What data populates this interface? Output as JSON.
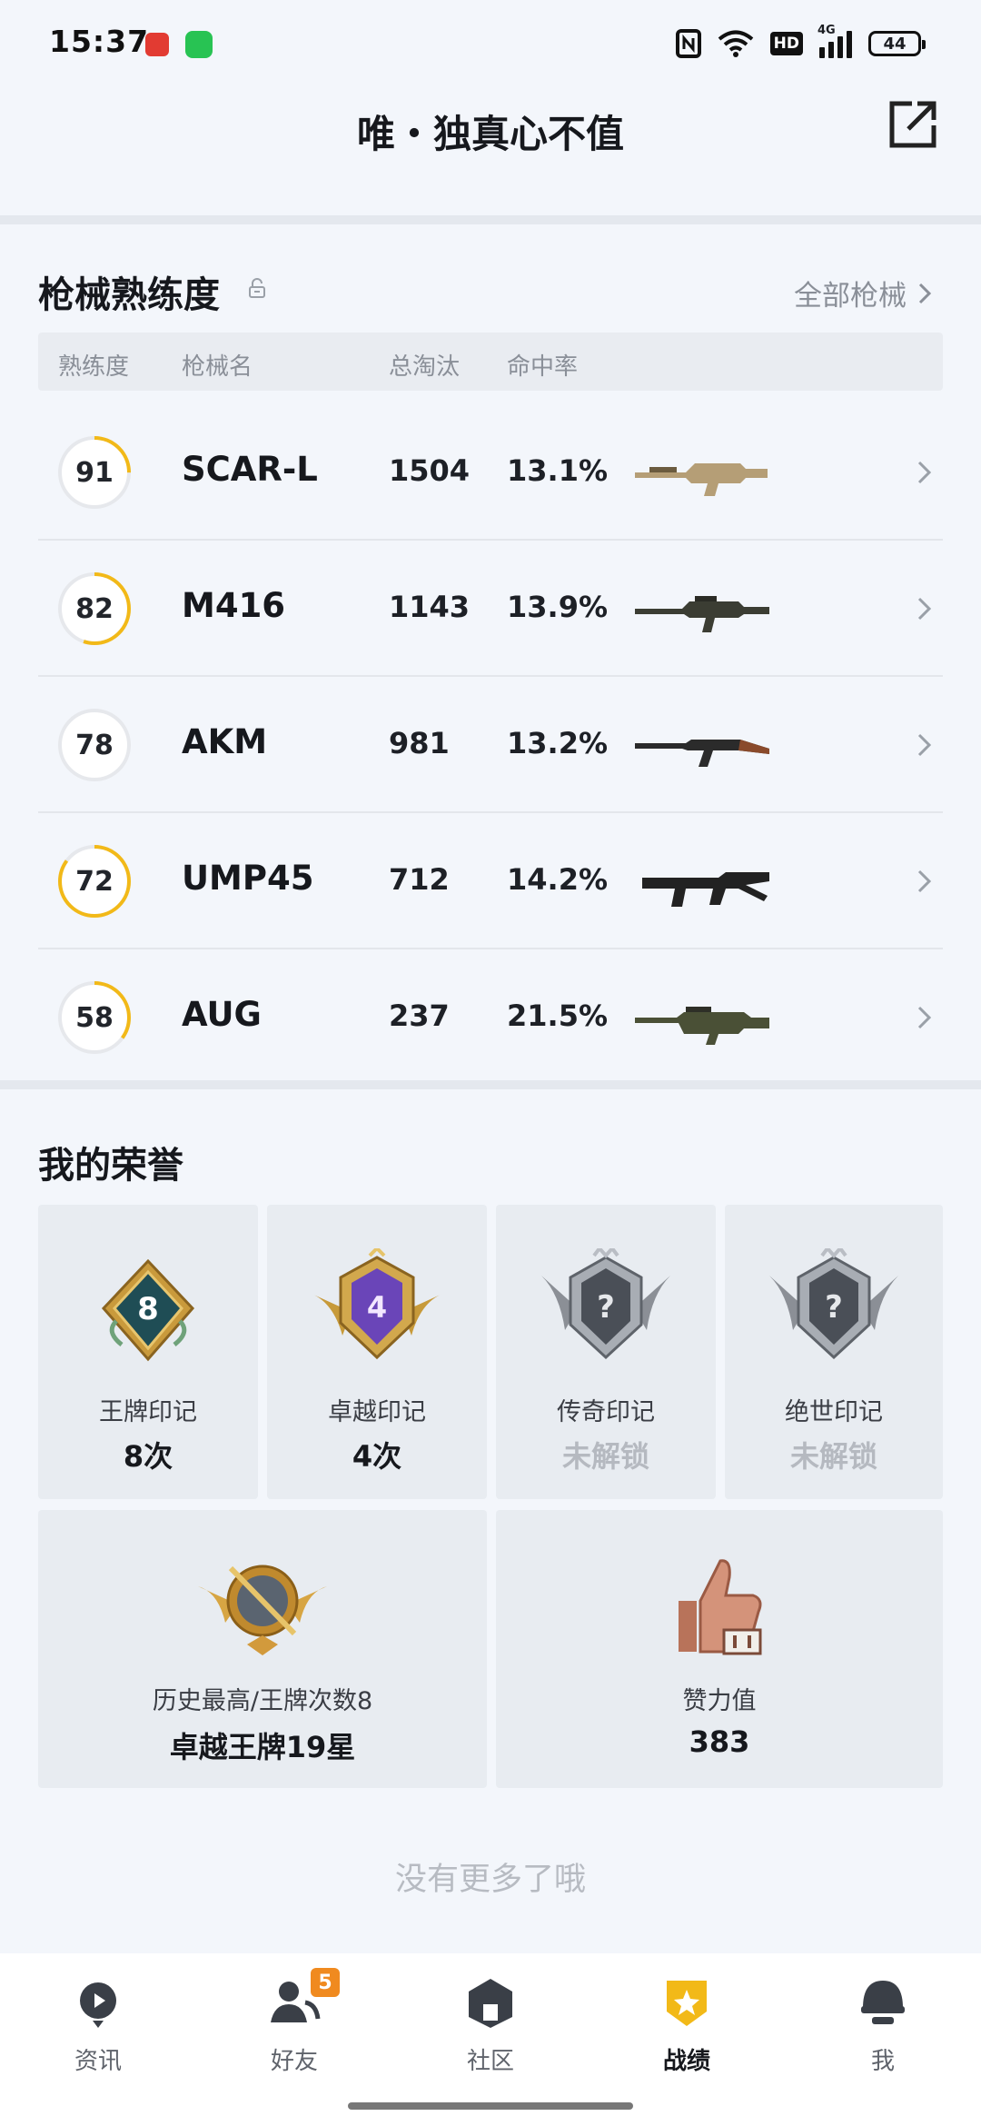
{
  "status_bar": {
    "time": "15:37",
    "network": "4G",
    "hd": "HD",
    "battery": "44"
  },
  "header": {
    "title": "唯・独真心不值"
  },
  "weapons": {
    "title": "枪械熟练度",
    "all_link": "全部枪械",
    "columns": [
      "熟练度",
      "枪械名",
      "总淘汰",
      "命中率"
    ],
    "rows": [
      {
        "proficiency": "91",
        "fill": 0.25,
        "name": "SCAR-L",
        "kills": "1504",
        "rate": "13.1%"
      },
      {
        "proficiency": "82",
        "fill": 0.55,
        "name": "M416",
        "kills": "1143",
        "rate": "13.9%"
      },
      {
        "proficiency": "78",
        "fill": 0.0,
        "name": "AKM",
        "kills": "981",
        "rate": "13.2%"
      },
      {
        "proficiency": "72",
        "fill": 0.85,
        "name": "UMP45",
        "kills": "712",
        "rate": "14.2%"
      },
      {
        "proficiency": "58",
        "fill": 0.35,
        "name": "AUG",
        "kills": "237",
        "rate": "21.5%"
      }
    ],
    "ring_color": "#f2b918"
  },
  "honors": {
    "title": "我的荣誉",
    "cards": [
      {
        "label": "王牌印记",
        "value": "8次",
        "badge_number": "8",
        "locked": false
      },
      {
        "label": "卓越印记",
        "value": "4次",
        "badge_number": "4",
        "locked": false
      },
      {
        "label": "传奇印记",
        "value": "未解锁",
        "badge_number": "?",
        "locked": true
      },
      {
        "label": "绝世印记",
        "value": "未解锁",
        "badge_number": "?",
        "locked": true
      }
    ],
    "history": {
      "label": "历史最高/王牌次数8",
      "value": "卓越王牌19星"
    },
    "effort": {
      "label": "赞力值",
      "value": "383"
    }
  },
  "footer_text": "没有更多了哦",
  "nav": {
    "items": [
      {
        "label": "资讯",
        "icon": "news-icon"
      },
      {
        "label": "好友",
        "icon": "friends-icon",
        "badge": "5"
      },
      {
        "label": "社区",
        "icon": "community-icon"
      },
      {
        "label": "战绩",
        "icon": "record-icon",
        "active": true
      },
      {
        "label": "我",
        "icon": "profile-icon"
      }
    ]
  }
}
